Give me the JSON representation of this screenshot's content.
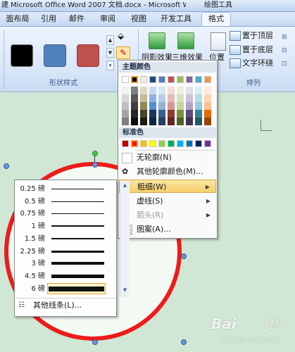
{
  "window": {
    "title": "建 Microsoft Office Word 2007 文档.docx - Microsoft W...",
    "contextual_tab_group": "绘图工具"
  },
  "tabs": [
    "面布局",
    "引用",
    "邮件",
    "审阅",
    "视图",
    "开发工具",
    "格式"
  ],
  "active_tab": "格式",
  "ribbon": {
    "shape_styles_label": "形状样式",
    "shadow_effect": "阴影效果",
    "threed_effect": "三维效果",
    "position": "位置",
    "arrange_label": "排列",
    "bring_to_front": "置于顶层",
    "send_to_back": "置于底层",
    "text_wrapping": "文字环绕",
    "style_swatches": [
      "#000000",
      "#4f81bd",
      "#c0504d"
    ]
  },
  "outline_menu": {
    "theme_colors_header": "主题颜色",
    "standard_colors_header": "标准色",
    "theme_colors_top": [
      "#ffffff",
      "#000000",
      "#eeece1",
      "#1f497d",
      "#4f81bd",
      "#c0504d",
      "#9bbb59",
      "#8064a2",
      "#4bacc6",
      "#f79646"
    ],
    "theme_colors_shades": [
      [
        "#f2f2f2",
        "#7f7f7f",
        "#ddd9c3",
        "#c6d9f0",
        "#dbe5f1",
        "#f2dcdb",
        "#ebf1dd",
        "#e5e0ec",
        "#dbeef3",
        "#fdeada"
      ],
      [
        "#d8d8d8",
        "#595959",
        "#c4bd97",
        "#8db3e2",
        "#b8cce4",
        "#e5b9b7",
        "#d7e3bc",
        "#ccc1d9",
        "#b7dde8",
        "#fbd5b5"
      ],
      [
        "#bfbfbf",
        "#3f3f3f",
        "#938953",
        "#548dd4",
        "#95b3d7",
        "#d99694",
        "#c3d69b",
        "#b2a2c7",
        "#92cddc",
        "#fac08f"
      ],
      [
        "#a5a5a5",
        "#262626",
        "#494429",
        "#17365d",
        "#366092",
        "#953734",
        "#76923c",
        "#5f497a",
        "#31859b",
        "#e36c09"
      ],
      [
        "#7f7f7f",
        "#0c0c0c",
        "#1d1b10",
        "#0f243e",
        "#244061",
        "#632423",
        "#4f6128",
        "#3f3151",
        "#205867",
        "#974806"
      ]
    ],
    "standard_colors": [
      "#c00000",
      "#ff0000",
      "#ffc000",
      "#ffff00",
      "#92d050",
      "#00b050",
      "#00b0f0",
      "#0070c0",
      "#002060",
      "#7030a0"
    ],
    "items": [
      {
        "label": "无轮廓(N)",
        "has_submenu": false
      },
      {
        "label": "其他轮廓颜色(M)...",
        "has_submenu": false
      },
      {
        "label": "粗细(W)",
        "has_submenu": true
      },
      {
        "label": "虚线(S)",
        "has_submenu": true
      },
      {
        "label": "箭头(R)",
        "has_submenu": true
      },
      {
        "label": "图案(A)...",
        "has_submenu": false
      }
    ]
  },
  "weight_menu": {
    "weights": [
      {
        "label": "0.25 磅",
        "stroke": 1
      },
      {
        "label": "0.5 磅",
        "stroke": 1
      },
      {
        "label": "0.75 磅",
        "stroke": 1
      },
      {
        "label": "1 磅",
        "stroke": 2
      },
      {
        "label": "1.5 磅",
        "stroke": 2
      },
      {
        "label": "2.25 磅",
        "stroke": 3
      },
      {
        "label": "3 磅",
        "stroke": 4
      },
      {
        "label": "4.5 磅",
        "stroke": 5
      },
      {
        "label": "6 磅",
        "stroke": 7
      }
    ],
    "selected": "6 磅",
    "more_lines": "其他线条(L)..."
  },
  "watermark": {
    "logo": "Bai",
    "logo_suffix": "经验",
    "url": "jingyan.baidu.com"
  }
}
